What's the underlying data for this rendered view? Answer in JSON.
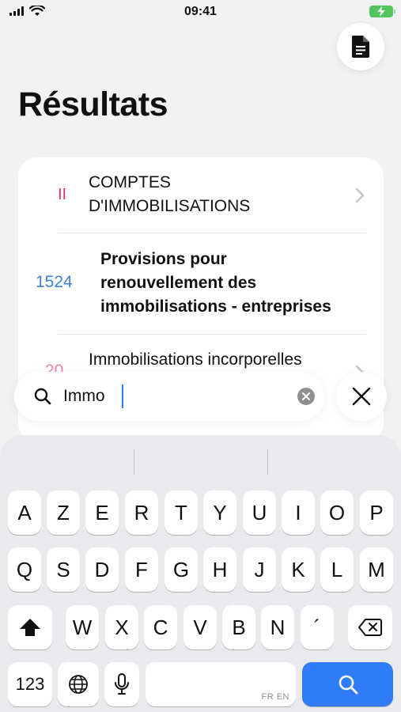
{
  "status_bar": {
    "time": "09:41"
  },
  "page": {
    "title": "Résultats"
  },
  "results": [
    {
      "code": "II",
      "code_color": "#d6327a",
      "text_lines": [
        "COMPTES",
        "D'IMMOBILISATIONS"
      ],
      "bold": false
    },
    {
      "code": "1524",
      "code_color": "#3b82d8",
      "text_lines": [
        "Provisions pour",
        "renouvellement des",
        "immobilisations - entreprises"
      ],
      "bold": true
    },
    {
      "code": "20",
      "code_color": "#d6327a",
      "text_lines": [
        "Immobilisations incorporelles"
      ],
      "bold": false
    }
  ],
  "search": {
    "value": "Immo",
    "placeholder": ""
  },
  "keyboard": {
    "row1": [
      "A",
      "Z",
      "E",
      "R",
      "T",
      "Y",
      "U",
      "I",
      "O",
      "P"
    ],
    "row2": [
      "Q",
      "S",
      "D",
      "F",
      "G",
      "H",
      "J",
      "K",
      "L",
      "M"
    ],
    "row3": [
      "W",
      "X",
      "C",
      "V",
      "B",
      "N",
      "´"
    ],
    "numbers_key": "123",
    "language_indicator": "FR EN"
  },
  "colors": {
    "accent": "#2f7cf6",
    "battery": "#52c65d",
    "chapter_code": "#d6327a",
    "account_code": "#3b82d8"
  },
  "icons": [
    "signal-icon",
    "wifi-icon",
    "battery-charging-icon",
    "document-icon",
    "chevron-right-icon",
    "search-icon",
    "clear-icon",
    "close-icon",
    "shift-icon",
    "backspace-icon",
    "globe-icon",
    "microphone-icon"
  ]
}
